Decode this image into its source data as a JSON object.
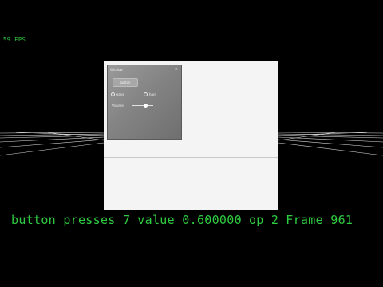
{
  "hud": {
    "fps": "59 FPS"
  },
  "window": {
    "title": "Window",
    "close_glyph": "×",
    "button_label": "button",
    "radios": [
      {
        "label": "easy",
        "selected": true
      },
      {
        "label": "hard",
        "selected": false
      }
    ],
    "slider": {
      "label": "Volume",
      "value": 0.6
    }
  },
  "status": {
    "button_presses": "button presses 7",
    "value": "value 0.600000",
    "op": "op 2",
    "frame": "Frame 961"
  },
  "colors": {
    "hud_green": "#2ecc40",
    "background": "#000000"
  }
}
